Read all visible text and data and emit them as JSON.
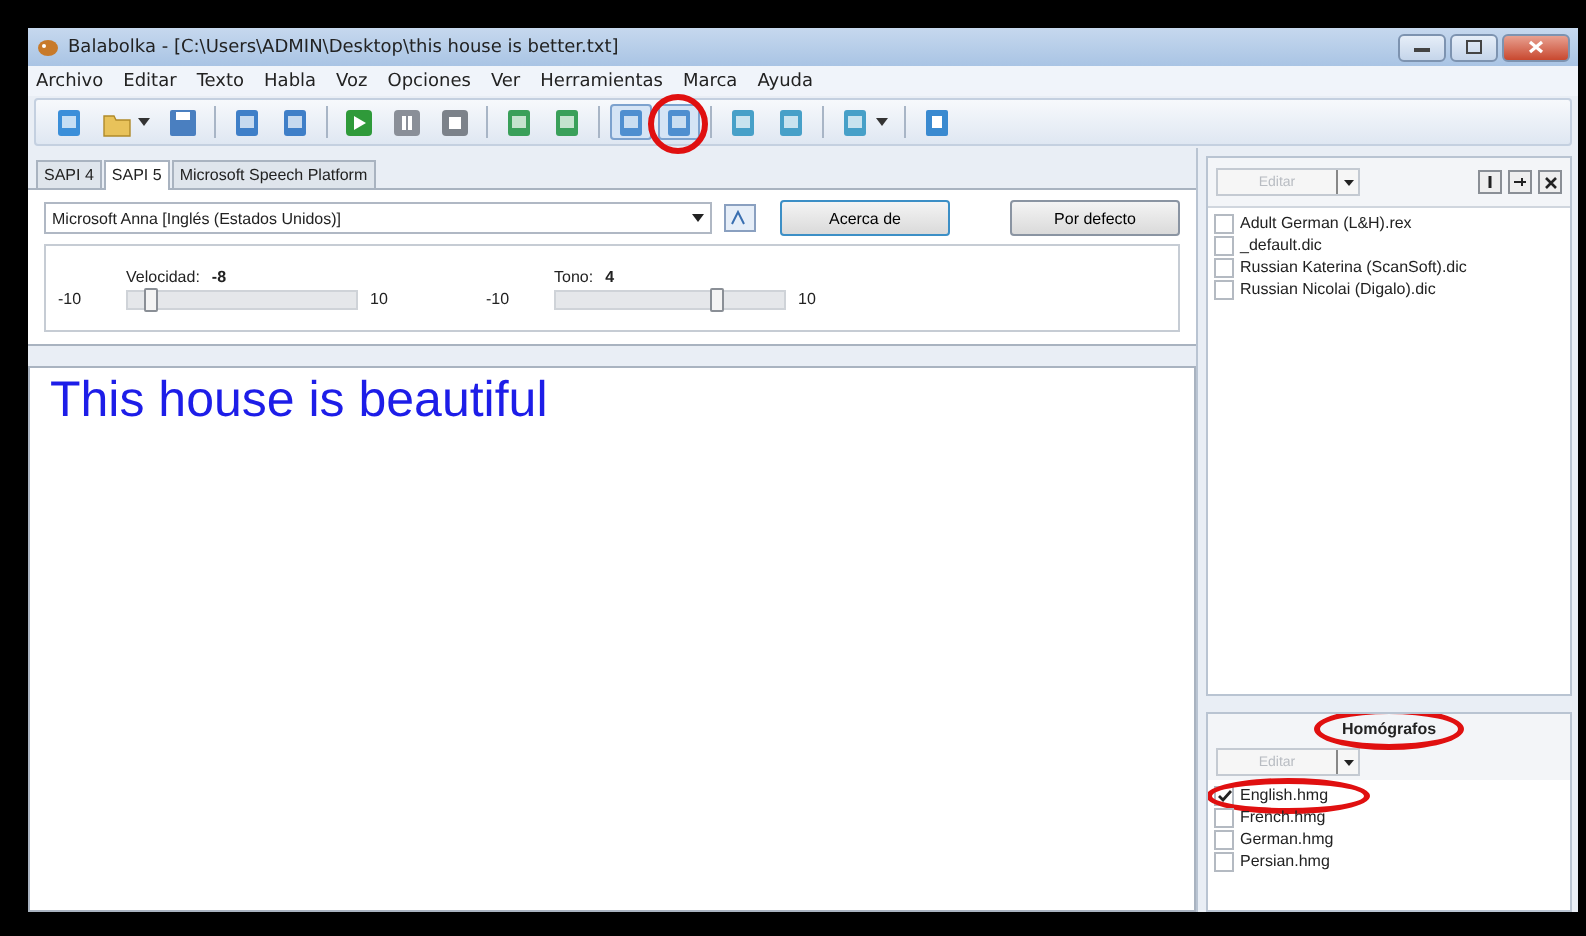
{
  "window": {
    "title": "Balabolka - [C:\\Users\\ADMIN\\Desktop\\this house is better.txt]"
  },
  "menu": [
    "Archivo",
    "Editar",
    "Texto",
    "Habla",
    "Voz",
    "Opciones",
    "Ver",
    "Herramientas",
    "Marca",
    "Ayuda"
  ],
  "toolbar": [
    {
      "kind": "doc",
      "dropdown": false,
      "pressed": false,
      "highlighted": false
    },
    {
      "kind": "folder",
      "dropdown": true,
      "pressed": false,
      "highlighted": false
    },
    {
      "kind": "save",
      "dropdown": false,
      "pressed": false,
      "highlighted": false
    },
    {
      "kind": "sep"
    },
    {
      "kind": "speak",
      "dropdown": false,
      "pressed": false,
      "highlighted": false
    },
    {
      "kind": "speak",
      "dropdown": false,
      "pressed": false,
      "highlighted": false
    },
    {
      "kind": "sep"
    },
    {
      "kind": "play",
      "dropdown": false,
      "pressed": false,
      "highlighted": false
    },
    {
      "kind": "pause",
      "dropdown": false,
      "pressed": false,
      "highlighted": false
    },
    {
      "kind": "stop",
      "dropdown": false,
      "pressed": false,
      "highlighted": false
    },
    {
      "kind": "sep"
    },
    {
      "kind": "file",
      "dropdown": false,
      "pressed": false,
      "highlighted": false
    },
    {
      "kind": "file",
      "dropdown": false,
      "pressed": false,
      "highlighted": false
    },
    {
      "kind": "sep"
    },
    {
      "kind": "panel",
      "dropdown": false,
      "pressed": true,
      "highlighted": false
    },
    {
      "kind": "panel",
      "dropdown": false,
      "pressed": true,
      "highlighted": true
    },
    {
      "kind": "sep"
    },
    {
      "kind": "book",
      "dropdown": false,
      "pressed": false,
      "highlighted": false
    },
    {
      "kind": "book",
      "dropdown": false,
      "pressed": false,
      "highlighted": false
    },
    {
      "kind": "sep"
    },
    {
      "kind": "book",
      "dropdown": true,
      "pressed": false,
      "highlighted": false
    },
    {
      "kind": "sep"
    },
    {
      "kind": "help",
      "dropdown": false,
      "pressed": false,
      "highlighted": false
    }
  ],
  "tabs": [
    {
      "label": "SAPI 4",
      "selected": false
    },
    {
      "label": "SAPI 5",
      "selected": true
    },
    {
      "label": "Microsoft Speech Platform",
      "selected": false
    }
  ],
  "voice": {
    "value": "Microsoft Anna [Inglés (Estados Unidos)]"
  },
  "buttons": [
    "Acerca de",
    "Por defecto"
  ],
  "sliders": [
    {
      "label": "Velocidad:",
      "value": "-8",
      "min": "-10",
      "max": "10",
      "level": 0.1
    },
    {
      "label": "Tono:",
      "value": "4",
      "min": "-10",
      "max": "10",
      "level": 0.7
    }
  ],
  "document": {
    "text": "This house is beautiful"
  },
  "dictionaries": {
    "edit_button": "Editar",
    "items": [
      {
        "label": "Adult German (L&H).rex",
        "checked": false
      },
      {
        "label": "_default.dic",
        "checked": false
      },
      {
        "label": "Russian Katerina (ScanSoft).dic",
        "checked": false
      },
      {
        "label": "Russian Nicolai (Digalo).dic",
        "checked": false
      }
    ]
  },
  "homographs": {
    "title": "Homógrafos",
    "title_highlighted": true,
    "edit_button": "Editar",
    "items": [
      {
        "label": "English.hmg",
        "checked": true,
        "highlighted": true
      },
      {
        "label": "French.hmg",
        "checked": false,
        "highlighted": false
      },
      {
        "label": "German.hmg",
        "checked": false,
        "highlighted": false
      },
      {
        "label": "Persian.hmg",
        "checked": false,
        "highlighted": false
      }
    ]
  }
}
